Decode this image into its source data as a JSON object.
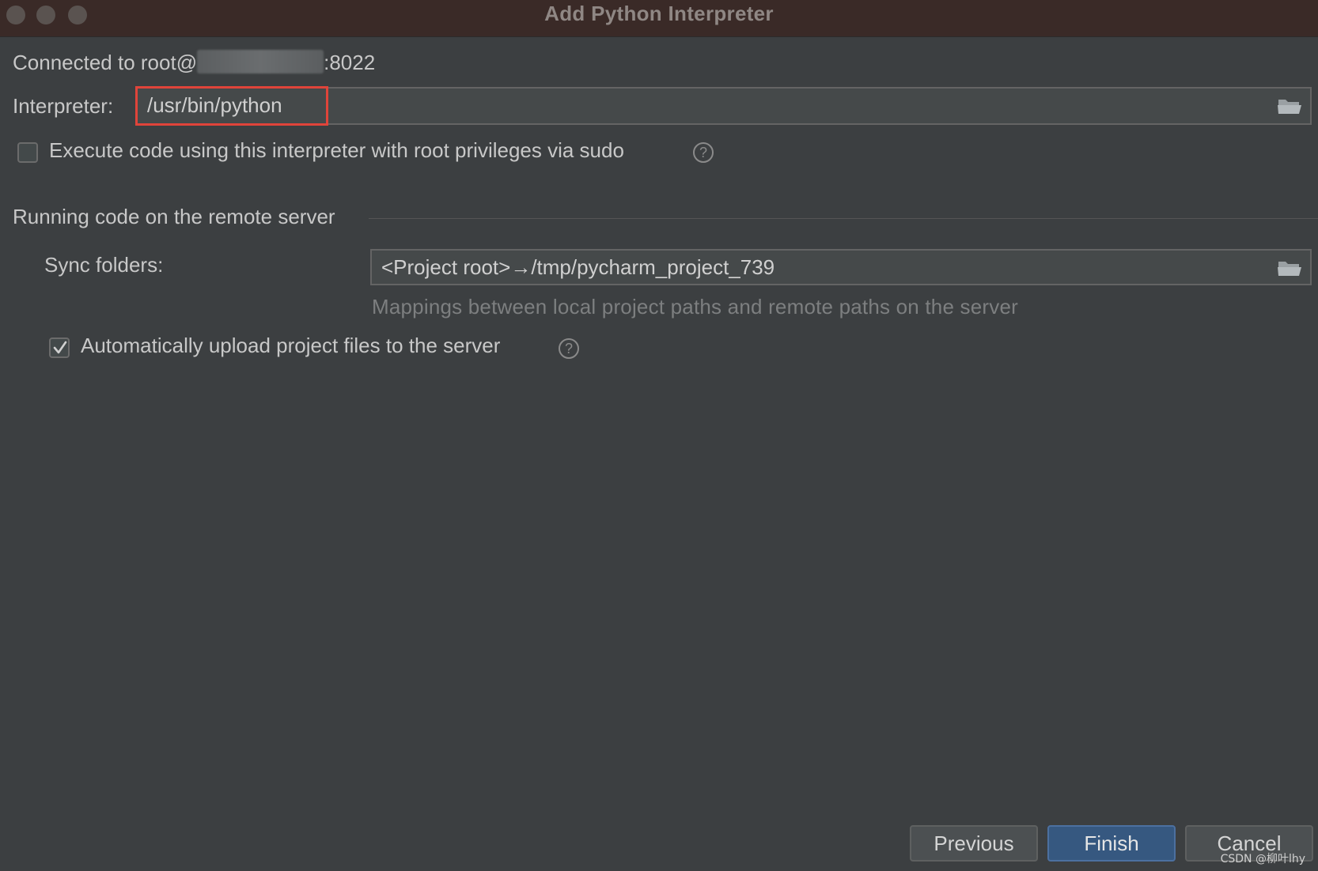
{
  "window": {
    "title": "Add Python Interpreter"
  },
  "connection": {
    "prefix": "Connected to root@",
    "suffix": ":8022"
  },
  "interpreter": {
    "label": "Interpreter:",
    "value": "/usr/bin/python"
  },
  "sudo_option": {
    "label": "Execute code using this interpreter with root privileges via sudo",
    "checked": false
  },
  "remote_section": {
    "title": "Running code on the remote server",
    "sync_label": "Sync folders:",
    "sync_value": "<Project root>→/tmp/pycharm_project_739",
    "sync_hint": "Mappings between local project paths and remote paths on the server",
    "auto_upload_label": "Automatically upload project files to the server",
    "auto_upload_checked": true
  },
  "buttons": {
    "previous": "Previous",
    "finish": "Finish",
    "cancel": "Cancel"
  },
  "watermark": "CSDN @柳叶lhy",
  "icons": {
    "browse": "folder-open-icon",
    "help": "question-circle-icon",
    "check": "checkmark-icon"
  },
  "colors": {
    "primary_button": "#365880",
    "highlight_box": "#e0443a",
    "background": "#3c3f41"
  }
}
